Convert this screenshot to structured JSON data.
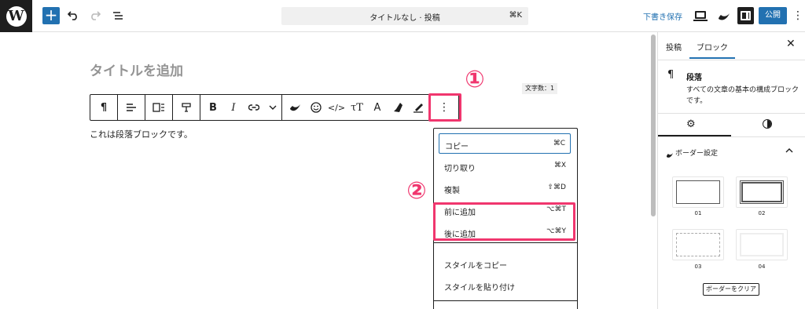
{
  "topbar": {
    "doc_title": "タイトルなし · 投稿",
    "cmd_shortcut": "⌘K",
    "draft_label": "下書き保存",
    "publish_label": "公開",
    "wp_logo": "W"
  },
  "editor": {
    "title_placeholder": "タイトルを追加",
    "word_count": "文字数：1",
    "paragraph_text": "これは段落ブロックです。",
    "toolbar_items": [
      "paragraph-icon",
      "align-icon",
      "media-text-icon",
      "format-icon",
      "bold-icon",
      "italic-icon",
      "link-icon",
      "chevron-down-icon",
      "plugin-icon",
      "emoji-icon",
      "code-icon",
      "font-size-icon",
      "text-color-icon",
      "highlighter-icon",
      "pen-icon",
      "more-options-icon"
    ],
    "annotation_1": "①",
    "annotation_2": "②"
  },
  "block_menu": {
    "items": [
      {
        "label": "コピー",
        "shortcut": "⌘C"
      },
      {
        "label": "切り取り",
        "shortcut": "⌘X"
      },
      {
        "label": "複製",
        "shortcut": "⇧⌘D"
      },
      {
        "label": "前に追加",
        "shortcut": "⌥⌘T"
      },
      {
        "label": "後に追加",
        "shortcut": "⌥⌘Y"
      },
      {
        "label": "スタイルをコピー",
        "shortcut": ""
      },
      {
        "label": "スタイルを貼り付け",
        "shortcut": ""
      }
    ]
  },
  "sidebar": {
    "tab_post": "投稿",
    "tab_block": "ブロック",
    "block_name": "段落",
    "block_description": "すべての文章の基本の構成ブロックです。",
    "panel_title": "ボーダー設定",
    "border_options": [
      "01",
      "02",
      "03",
      "04"
    ],
    "clear_label": "ボーダーをクリア"
  },
  "colors": {
    "accent": "#2271b1",
    "annotation": "#f0366e",
    "dark": "#1e1e1e"
  }
}
